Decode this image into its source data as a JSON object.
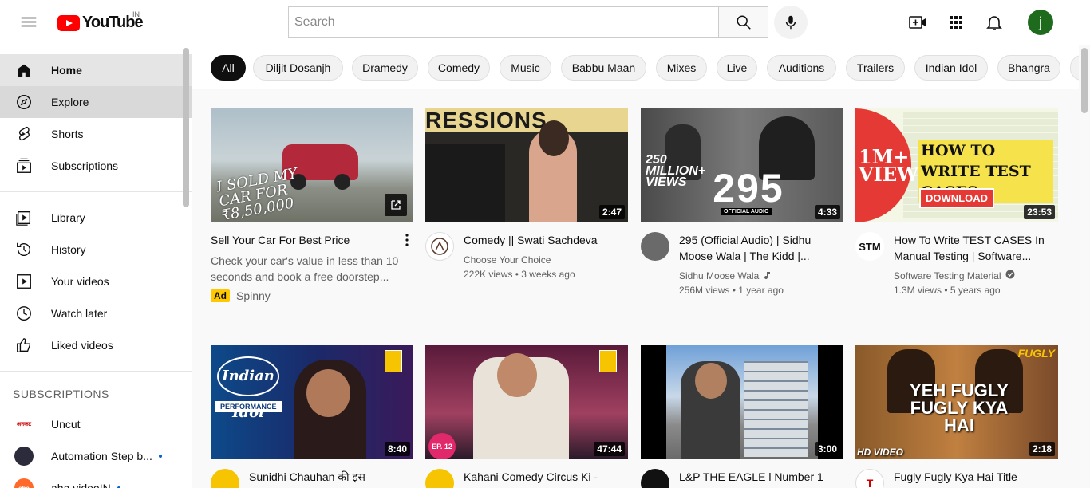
{
  "header": {
    "logo_text": "YouTube",
    "country": "IN",
    "search_placeholder": "Search",
    "avatar_letter": "j"
  },
  "sidebar": {
    "main": [
      {
        "label": "Home",
        "icon": "home-icon"
      },
      {
        "label": "Explore",
        "icon": "compass-icon"
      },
      {
        "label": "Shorts",
        "icon": "shorts-icon"
      },
      {
        "label": "Subscriptions",
        "icon": "subscriptions-icon"
      }
    ],
    "library": [
      {
        "label": "Library",
        "icon": "library-icon"
      },
      {
        "label": "History",
        "icon": "history-icon"
      },
      {
        "label": "Your videos",
        "icon": "your-videos-icon"
      },
      {
        "label": "Watch later",
        "icon": "watch-later-icon"
      },
      {
        "label": "Liked videos",
        "icon": "thumbs-up-icon"
      }
    ],
    "subscriptions_heading": "SUBSCRIPTIONS",
    "subscriptions": [
      {
        "label": "Uncut",
        "avatar_text": "अनकट"
      },
      {
        "label": "Automation Step b...",
        "avatar_text": ""
      },
      {
        "label": "aha videoIN",
        "avatar_text": "aha"
      }
    ]
  },
  "chips": [
    "All",
    "Diljit Dosanjh",
    "Dramedy",
    "Comedy",
    "Music",
    "Babbu Maan",
    "Mixes",
    "Live",
    "Auditions",
    "Trailers",
    "Indian Idol",
    "Bhangra"
  ],
  "videos": [
    {
      "title": "Sell Your Car For Best Price",
      "description": "Check your car's value in less than 10 seconds and book a free doorstep...",
      "ad_label": "Ad",
      "channel": "Spinny",
      "thumb_text": "I SOLD MY CAR FOR ₹8,50,000"
    },
    {
      "title": "Comedy || Swati Sachdeva",
      "channel": "Choose Your Choice",
      "stats": "222K views • 3 weeks ago",
      "duration": "2:47",
      "thumb_text": "RESSIONS"
    },
    {
      "title": "295 (Official Audio) | Sidhu Moose Wala | The Kidd |...",
      "channel": "Sidhu Moose Wala",
      "stats": "256M views • 1 year ago",
      "duration": "4:33",
      "thumb_text": "295",
      "thumb_sub": "OFFICIAL AUDIO",
      "thumb_badge": "250 MILLION+ VIEWS"
    },
    {
      "title": "How To Write TEST CASES In Manual Testing | Software...",
      "channel": "Software Testing Material",
      "stats": "1.3M views • 5 years ago",
      "duration": "23:53",
      "thumb_text": "HOW TO WRITE TEST CASES",
      "thumb_badge": "1M+ VIEWS",
      "thumb_button": "DOWNLOAD"
    },
    {
      "title": "Sunidhi Chauhan की इस",
      "duration": "8:40",
      "thumb_text": "Indian Idol",
      "thumb_sub": "PERFORMANCE"
    },
    {
      "title": "Kahani Comedy Circus Ki -",
      "duration": "47:44",
      "thumb_sub": "EP. 12"
    },
    {
      "title": "L&P THE EAGLE l Number 1",
      "duration": "3:00"
    },
    {
      "title": "Fugly Fugly Kya Hai Title",
      "duration": "2:18",
      "thumb_text": "YEH FUGLY FUGLY KYA HAI",
      "thumb_badge": "FUGLY",
      "thumb_sub": "HD VIDEO"
    }
  ]
}
